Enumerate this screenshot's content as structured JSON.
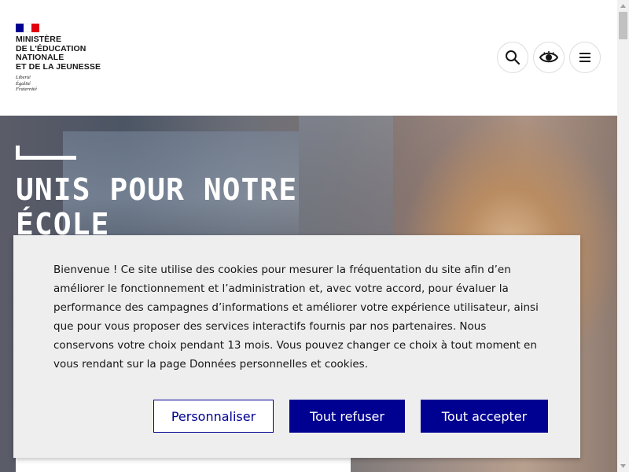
{
  "header": {
    "ministry_lines": [
      "MINISTÈRE",
      "DE L'ÉDUCATION",
      "NATIONALE",
      "ET DE LA JEUNESSE"
    ],
    "motto_lines": [
      "Liberté",
      "Égalité",
      "Fraternité"
    ],
    "buttons": {
      "search_icon": "search-icon",
      "accessibility_icon": "eye-icon",
      "menu_icon": "menu-icon"
    }
  },
  "hero": {
    "title": "UNIS POUR NOTRE ÉCOLE"
  },
  "cookie_banner": {
    "text": "Bienvenue ! Ce site utilise des cookies pour mesurer la fréquentation du site afin d’en améliorer le fonctionnement et l’administration et, avec votre accord, pour évaluer la performance des campagnes d’informations et améliorer votre expérience utilisateur, ainsi que pour vous proposer des services interactifs fournis par nos partenaires. Nous conservons votre choix pendant 13 mois. Vous pouvez changer ce choix à tout moment en vous rendant sur la page Données personnelles et cookies.",
    "customize_label": "Personnaliser",
    "refuse_label": "Tout refuser",
    "accept_label": "Tout accepter"
  },
  "colors": {
    "brand_blue": "#000091",
    "brand_red": "#e1000f",
    "banner_bg": "#eeeeee"
  }
}
